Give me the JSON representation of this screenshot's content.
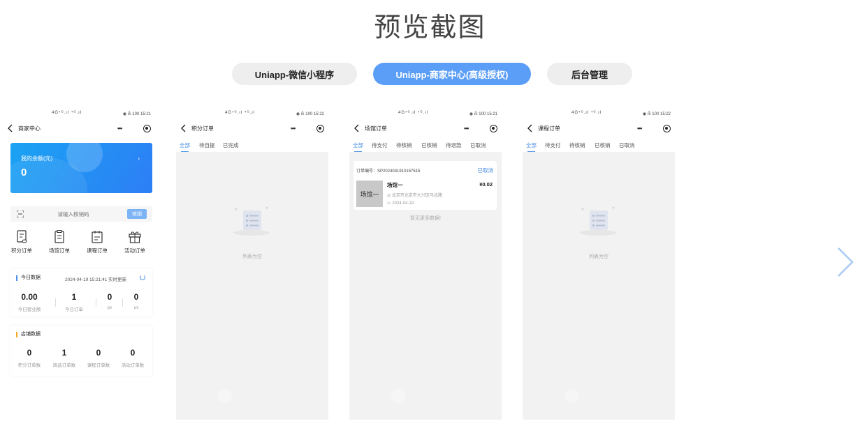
{
  "page_title": "预览截图",
  "tabs": [
    {
      "label": "Uniapp-微信小程序",
      "active": false
    },
    {
      "label": "Uniapp-商家中心(高级授权)",
      "active": true
    },
    {
      "label": "后台管理",
      "active": false
    }
  ],
  "status": {
    "signal": "4G⁴ᴳ.ıl ⁴ᴳ.ıl",
    "icons": "◉ ıÎı 100"
  },
  "phones": [
    {
      "time": "15:21",
      "title": "商家中心",
      "balance": {
        "label": "我的余额(元)",
        "amount": "0"
      },
      "scan": {
        "placeholder": "请输入核销码",
        "button": "核销"
      },
      "shortcuts": [
        "积分订单",
        "场馆订单",
        "课程订单",
        "活动订单"
      ],
      "today": {
        "title": "今日数据",
        "timestamp": "2024-04-19 15:21:41 实时更新",
        "stats": [
          {
            "value": "0.00",
            "label": "今日营业额"
          },
          {
            "value": "1",
            "label": "今日订单"
          },
          {
            "value": "0",
            "label": "pv"
          },
          {
            "value": "0",
            "label": "uv"
          }
        ]
      },
      "shop": {
        "title": "店铺数据",
        "stats": [
          {
            "value": "0",
            "label": "积分订单数"
          },
          {
            "value": "1",
            "label": "商品订单数"
          },
          {
            "value": "0",
            "label": "课程订单数"
          },
          {
            "value": "0",
            "label": "活动订单数"
          }
        ]
      }
    },
    {
      "time": "15:22",
      "title": "积分订单",
      "tabs": [
        "全部",
        "待自提",
        "已完成"
      ],
      "empty_text": "列表为空"
    },
    {
      "time": "15:21",
      "title": "场馆订单",
      "tabs": [
        "全部",
        "待支付",
        "待核销",
        "已核销",
        "待退款",
        "已取消"
      ],
      "order": {
        "number": "订单编号：SP2024041910157515",
        "status": "已取消",
        "thumb": "场馆一",
        "name": "场馆一",
        "price": "¥0.02",
        "address": "北京市北京市大兴区马北路",
        "date": "2024-04-19"
      },
      "no_more": "暂无更多数据!"
    },
    {
      "time": "15:22",
      "title": "课程订单",
      "tabs": [
        "全部",
        "待支付",
        "待核销",
        "已核销",
        "已取消"
      ],
      "empty_text": "列表为空"
    }
  ],
  "colors": {
    "accent": "#5b9ef7",
    "active_tab": "#4a8ee6",
    "balance_start": "#1aa3f3",
    "balance_end": "#2d7ef5"
  }
}
